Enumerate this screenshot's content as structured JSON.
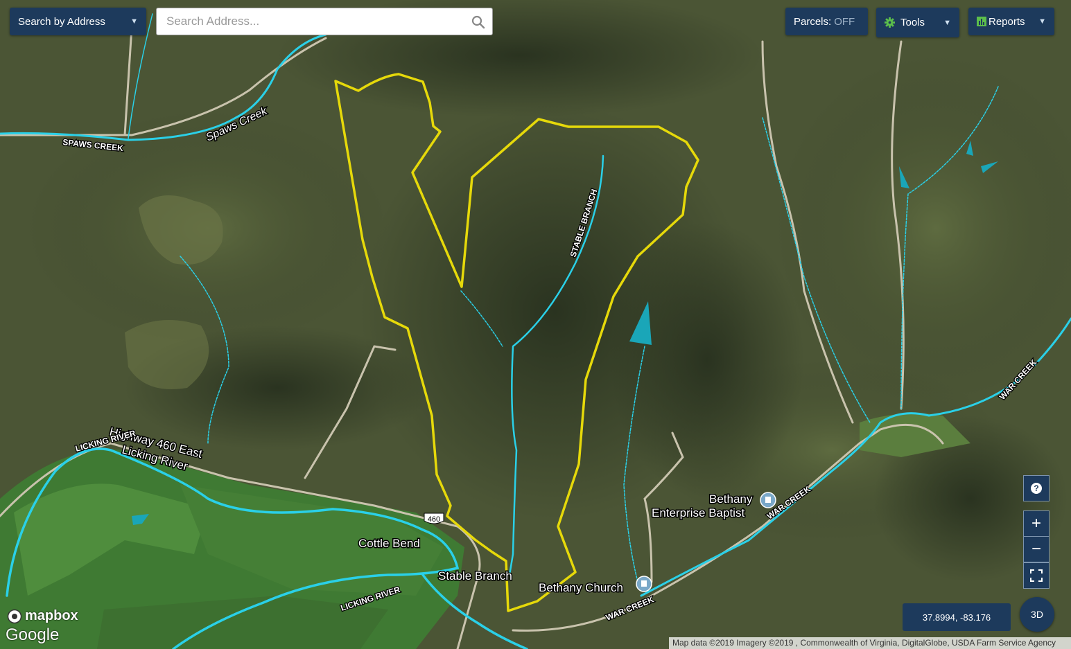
{
  "toolbar": {
    "search_mode_label": "Search by Address",
    "search_placeholder": "Search Address...",
    "parcels_label": "Parcels:",
    "parcels_state": "OFF",
    "tools_label": "Tools",
    "reports_label": "Reports"
  },
  "map": {
    "place_labels": {
      "highway": "Highway 460 East",
      "route_shield": "460",
      "licking_river_area": "Licking River",
      "cottle_bend": "Cottle Bend",
      "stable_branch": "Stable Branch",
      "bethany_church": "Bethany Church",
      "bethany_baptist_line1": "Bethany",
      "bethany_baptist_line2": "Enterprise Baptist",
      "spaws_creek_italic": "Spaws Creek"
    },
    "stream_labels": {
      "spaws_creek": "SPAWS CREEK",
      "stable_branch": "STABLE BRANCH",
      "licking_river_1": "LICKING RIVER",
      "licking_river_2": "LICKING RIVER",
      "war_creek_1": "WAR CREEK",
      "war_creek_2": "WAR CREEK",
      "war_creek_3": "WAR CREEK"
    },
    "colors": {
      "parcel_boundary": "#e6d90a",
      "stream": "#2ad0e8",
      "pond": "#1aa6b8",
      "ui_panel": "#1d3a5c"
    }
  },
  "controls": {
    "help": "?",
    "zoom_in": "+",
    "zoom_out": "−",
    "coordinates": "37.8994, -83.176",
    "view_3d": "3D"
  },
  "attribution": {
    "mapbox": "mapbox",
    "google": "Google",
    "text": "Map data ©2019 Imagery ©2019 , Commonwealth of Virginia, DigitalGlobe, USDA Farm Service Agency"
  }
}
